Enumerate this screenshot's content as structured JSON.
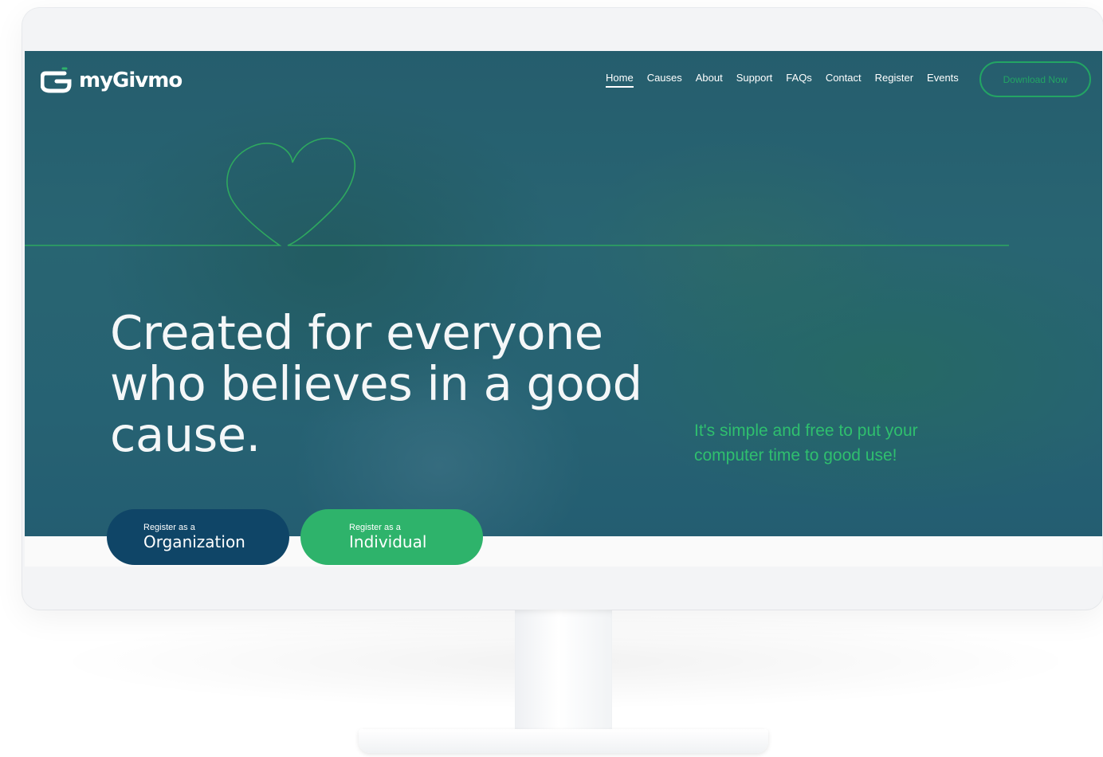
{
  "brand": {
    "name": "myGivmo",
    "logo_icon": "givmo-logo-icon"
  },
  "nav": {
    "items": [
      "Home",
      "Causes",
      "About",
      "Support",
      "FAQs",
      "Contact",
      "Register",
      "Events"
    ],
    "active": "Home",
    "download_label": "Download Now"
  },
  "hero": {
    "headline_lines": [
      "Created for everyone",
      "who believes in a good",
      "cause."
    ],
    "tagline_lines": [
      "It's simple and free to put your",
      "computer time to good use!"
    ],
    "decoration": "heart-line-icon"
  },
  "register": {
    "organization": {
      "prefix": "Register as a",
      "label": "Organization"
    },
    "individual": {
      "prefix": "Register as a",
      "label": "Individual"
    }
  },
  "colors": {
    "accent_green": "#2eb36b",
    "navy": "#0f4567",
    "hero_tint": "#2a5f6e"
  }
}
